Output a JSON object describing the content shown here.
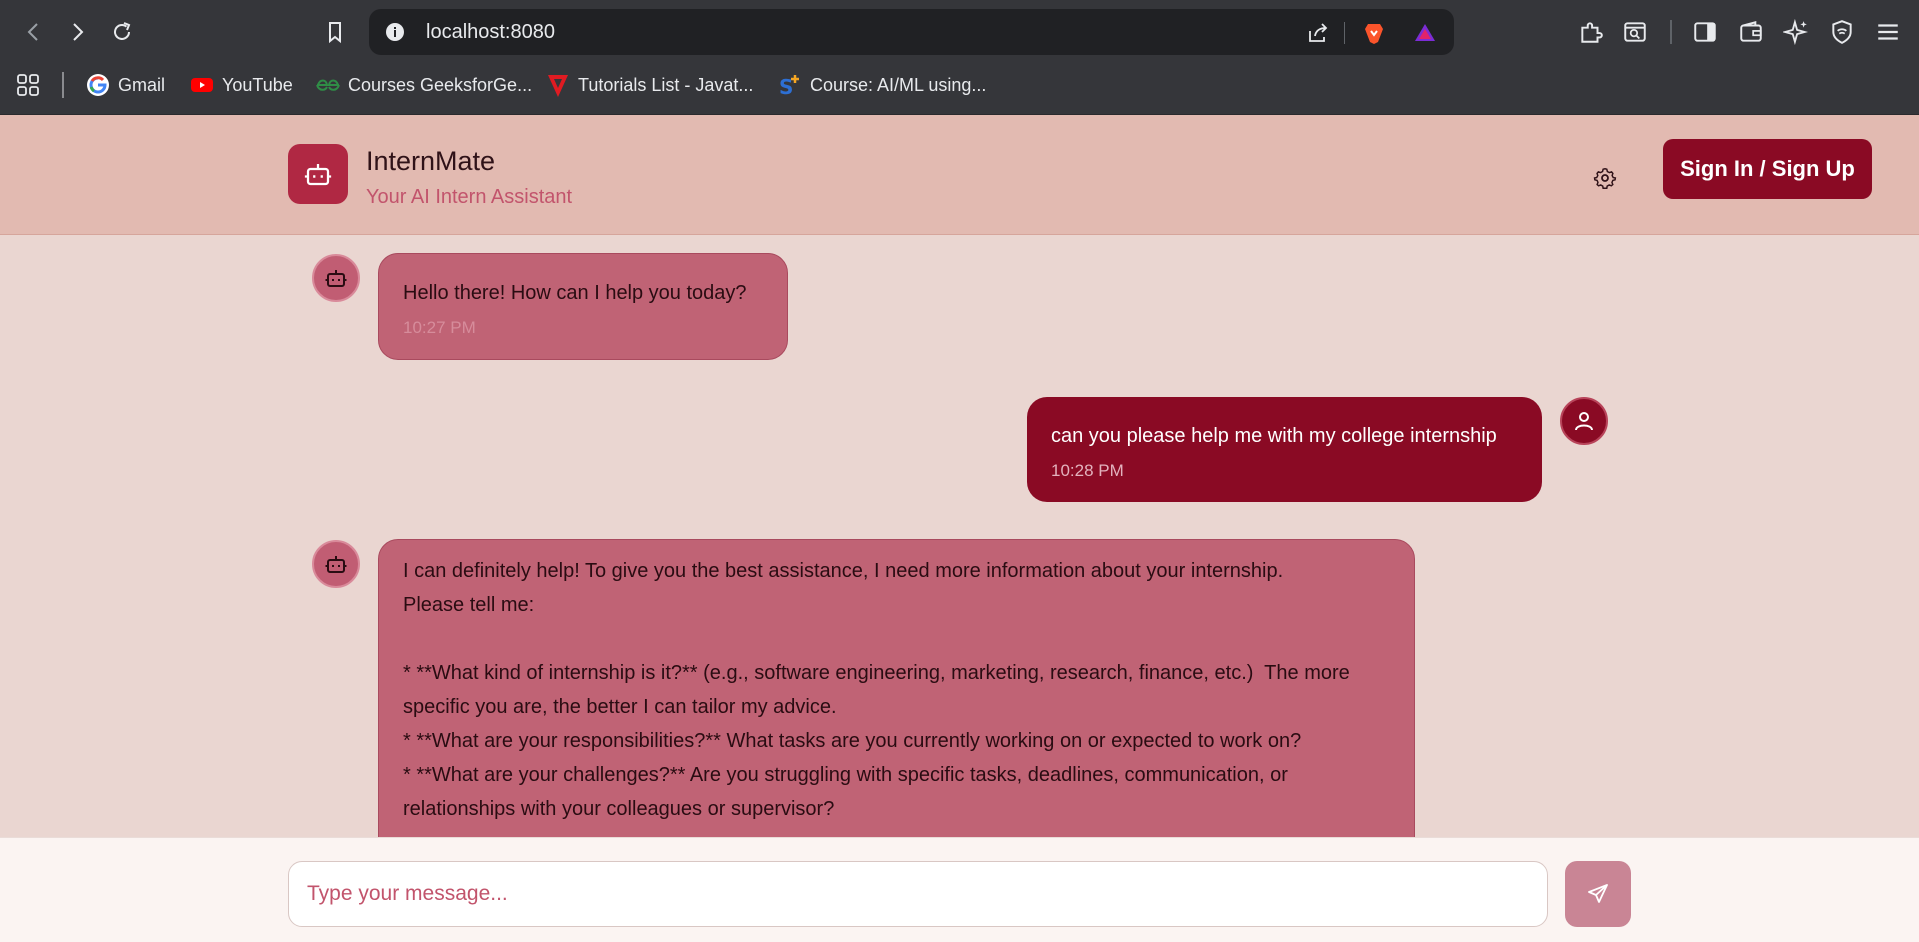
{
  "browser": {
    "url": "localhost:8080",
    "bookmarks": [
      {
        "label": "Gmail",
        "icon": "google-icon"
      },
      {
        "label": "YouTube",
        "icon": "youtube-icon"
      },
      {
        "label": "Courses GeeksforGe...",
        "icon": "geeksforgeeks-icon"
      },
      {
        "label": "Tutorials List - Javat...",
        "icon": "javatpoint-icon"
      },
      {
        "label": "Course: AI/ML using...",
        "icon": "course-icon"
      }
    ]
  },
  "header": {
    "title": "InternMate",
    "subtitle": "Your AI Intern Assistant",
    "signin_label": "Sign In / Sign Up"
  },
  "messages": [
    {
      "role": "bot",
      "text": "Hello there! How can I help you today?",
      "time": "10:27 PM"
    },
    {
      "role": "user",
      "text": "can you please help me with my college internship",
      "time": "10:28 PM"
    },
    {
      "role": "bot",
      "text": "I can definitely help! To give you the best assistance, I need more information about your internship.\nPlease tell me:\n\n* **What kind of internship is it?** (e.g., software engineering, marketing, research, finance, etc.)  The more\nspecific you are, the better I can tailor my advice.\n* **What are your responsibilities?** What tasks are you currently working on or expected to work on?\n* **What are your challenges?** Are you struggling with specific tasks, deadlines, communication, or\nrelationships with your colleagues or supervisor?"
    }
  ],
  "composer": {
    "placeholder": "Type your message..."
  },
  "colors": {
    "accent": "#8a0a24",
    "header_bg": "#e2bab1",
    "chat_bg": "#ead6d1",
    "bot_bubble": "#c06375"
  }
}
